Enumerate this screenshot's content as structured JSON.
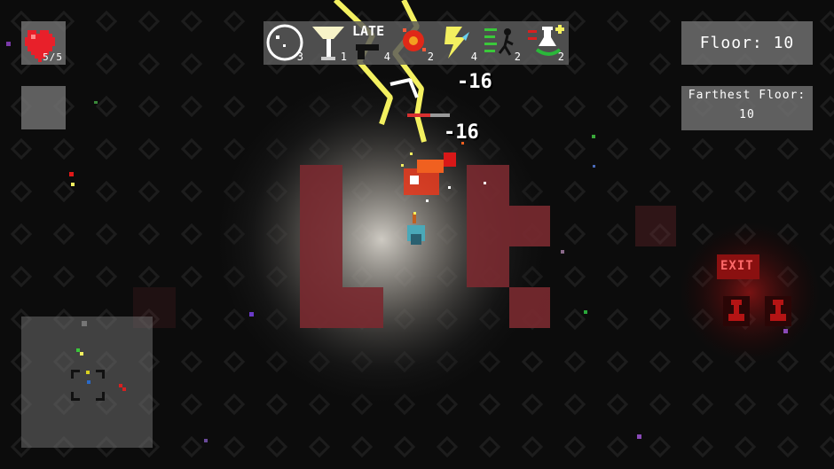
{
  "hud": {
    "health": "5/5",
    "floor": "Floor: 10",
    "farthest_label": "Farthest Floor:",
    "farthest_value": "10"
  },
  "items": [
    {
      "icon": "clock-icon",
      "count": "3"
    },
    {
      "icon": "lamp-icon",
      "count": "1"
    },
    {
      "icon": "gun-icon",
      "label": "LATE",
      "count": "4"
    },
    {
      "icon": "fireball-icon",
      "count": "2"
    },
    {
      "icon": "lightning-icon",
      "count": "4"
    },
    {
      "icon": "runner-icon",
      "count": "2"
    },
    {
      "icon": "potion-icon",
      "count": "2"
    }
  ],
  "damage": [
    "-16",
    "-16"
  ],
  "exit_sign": "EXIT",
  "colors": {
    "heart": "#e8202a",
    "blood_tile": "#7a2a30",
    "lightning": "#f3f060"
  }
}
